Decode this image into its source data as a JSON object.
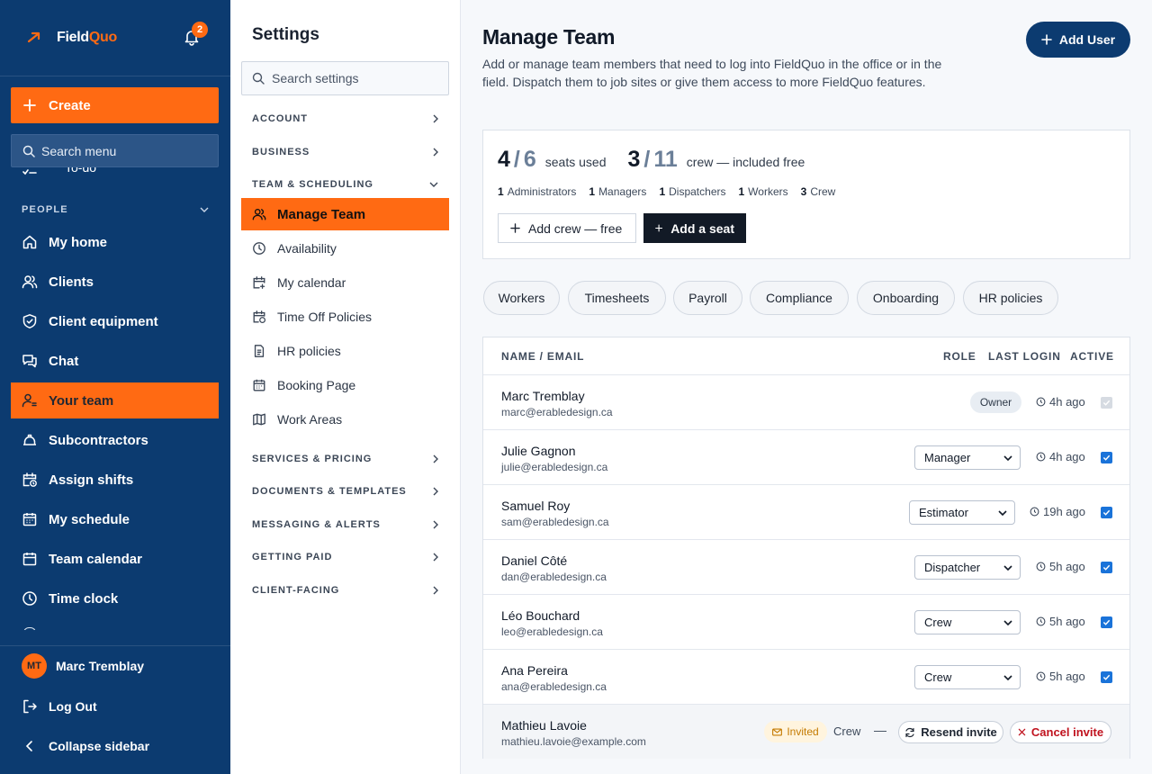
{
  "colors": {
    "sidebar": "#0c3b70",
    "accent": "#ff6a13",
    "primary": "#0c3b70",
    "check": "#1a73d9",
    "danger": "#c0121e"
  },
  "brand": {
    "name_part1": "Field",
    "name_part2": "Quo",
    "notifications": "2"
  },
  "sidebar": {
    "create_label": "Create",
    "search_placeholder": "Search menu",
    "todo_peek": "To-do",
    "section_label": "PEOPLE",
    "items": [
      {
        "label": "My home",
        "icon": "home-icon"
      },
      {
        "label": "Clients",
        "icon": "users-icon"
      },
      {
        "label": "Client equipment",
        "icon": "shield-icon"
      },
      {
        "label": "Chat",
        "icon": "chat-icon"
      },
      {
        "label": "Your team",
        "icon": "user-gear-icon",
        "active": true
      },
      {
        "label": "Subcontractors",
        "icon": "hardhat-icon"
      },
      {
        "label": "Assign shifts",
        "icon": "calendar-clock-icon"
      },
      {
        "label": "My schedule",
        "icon": "calendar-grid-icon"
      },
      {
        "label": "Team calendar",
        "icon": "calendar-icon"
      },
      {
        "label": "Time clock",
        "icon": "clock-icon"
      }
    ],
    "user": {
      "initials": "MT",
      "name": "Marc Tremblay"
    },
    "logout_label": "Log Out",
    "collapse_label": "Collapse sidebar"
  },
  "settings": {
    "title": "Settings",
    "search_placeholder": "Search settings",
    "groups": [
      {
        "label": "ACCOUNT",
        "state": "collapsed"
      },
      {
        "label": "BUSINESS",
        "state": "collapsed"
      },
      {
        "label": "TEAM & SCHEDULING",
        "state": "expanded"
      },
      {
        "label": "SERVICES & PRICING",
        "state": "collapsed"
      },
      {
        "label": "DOCUMENTS & TEMPLATES",
        "state": "collapsed"
      },
      {
        "label": "MESSAGING & ALERTS",
        "state": "collapsed"
      },
      {
        "label": "GETTING PAID",
        "state": "collapsed"
      },
      {
        "label": "CLIENT-FACING",
        "state": "collapsed"
      }
    ],
    "team_items": [
      {
        "label": "Manage Team",
        "icon": "users-icon",
        "active": true
      },
      {
        "label": "Availability",
        "icon": "clock-icon"
      },
      {
        "label": "My calendar",
        "icon": "calendar-plus-icon"
      },
      {
        "label": "Time Off Policies",
        "icon": "calendar-clock-icon"
      },
      {
        "label": "HR policies",
        "icon": "document-icon"
      },
      {
        "label": "Booking Page",
        "icon": "calendar-grid-icon"
      },
      {
        "label": "Work Areas",
        "icon": "map-icon"
      }
    ]
  },
  "main": {
    "title": "Manage Team",
    "description": "Add or manage team members that need to log into FieldQuo in the office or in the field. Dispatch them to job sites or give them access to more FieldQuo features.",
    "add_user_label": "Add User",
    "seats": {
      "used": "4",
      "total": "6",
      "used_label": "seats used",
      "crew_used": "3",
      "crew_total": "11",
      "crew_label": "crew — included free",
      "counts": [
        {
          "n": "1",
          "label": "Administrators"
        },
        {
          "n": "1",
          "label": "Managers"
        },
        {
          "n": "1",
          "label": "Dispatchers"
        },
        {
          "n": "1",
          "label": "Workers"
        },
        {
          "n": "3",
          "label": "Crew"
        }
      ],
      "add_crew_label": "Add crew — free",
      "add_seat_label": "Add a seat"
    },
    "tabs": [
      "Workers",
      "Timesheets",
      "Payroll",
      "Compliance",
      "Onboarding",
      "HR policies"
    ],
    "table": {
      "headers": {
        "name": "NAME / EMAIL",
        "role": "ROLE",
        "last_login": "LAST LOGIN",
        "active": "ACTIVE"
      },
      "rows": [
        {
          "name": "Marc Tremblay",
          "email": "marc@erabledesign.ca",
          "role": "Owner",
          "last_login": "4h ago",
          "active": true,
          "locked": true
        },
        {
          "name": "Julie Gagnon",
          "email": "julie@erabledesign.ca",
          "role": "Manager",
          "last_login": "4h ago",
          "active": true
        },
        {
          "name": "Samuel Roy",
          "email": "sam@erabledesign.ca",
          "role": "Estimator",
          "last_login": "19h ago",
          "active": true
        },
        {
          "name": "Daniel Côté",
          "email": "dan@erabledesign.ca",
          "role": "Dispatcher",
          "last_login": "5h ago",
          "active": true
        },
        {
          "name": "Léo Bouchard",
          "email": "leo@erabledesign.ca",
          "role": "Crew",
          "last_login": "5h ago",
          "active": true
        },
        {
          "name": "Ana Pereira",
          "email": "ana@erabledesign.ca",
          "role": "Crew",
          "last_login": "5h ago",
          "active": true
        }
      ],
      "invited": {
        "name": "Mathieu Lavoie",
        "email": "mathieu.lavoie@example.com",
        "status": "Invited",
        "role": "Crew",
        "last_login": "—",
        "resend_label": "Resend invite",
        "cancel_label": "Cancel invite"
      }
    }
  }
}
